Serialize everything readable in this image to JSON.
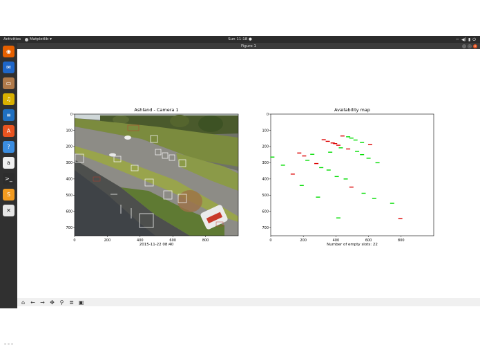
{
  "topbar": {
    "activities": "Activities",
    "app_name": "Matplotlib ▾",
    "clock": "Sun 11:18 ●",
    "tray_icons": [
      "wifi-icon",
      "volume-icon",
      "battery-icon",
      "power-icon"
    ]
  },
  "window": {
    "title": "Figure 1",
    "buttons": [
      "minimize",
      "maximize",
      "close"
    ]
  },
  "dock": {
    "apps": [
      {
        "name": "firefox-icon",
        "glyph": "◉",
        "color": "#e66000"
      },
      {
        "name": "thunderbird-icon",
        "glyph": "✉",
        "color": "#1e66c8"
      },
      {
        "name": "files-icon",
        "glyph": "▭",
        "color": "#b07a4a"
      },
      {
        "name": "rhythmbox-icon",
        "glyph": "♫",
        "color": "#d9b000"
      },
      {
        "name": "writer-icon",
        "glyph": "≡",
        "color": "#1f70c1"
      },
      {
        "name": "software-icon",
        "glyph": "A",
        "color": "#e95420"
      },
      {
        "name": "help-icon",
        "glyph": "?",
        "color": "#3b8de0"
      },
      {
        "name": "amazon-icon",
        "glyph": "a",
        "color": "#f0f0f0"
      },
      {
        "name": "terminal-icon",
        "glyph": ">_",
        "color": "#2d2d2d"
      },
      {
        "name": "sublime-icon",
        "glyph": "S",
        "color": "#f29b20"
      },
      {
        "name": "tool-icon",
        "glyph": "✕",
        "color": "#e6e6e6"
      }
    ]
  },
  "figure": {
    "left_title": "Ashland - Camera 1",
    "left_xlabel": "2015-11-22 08:40",
    "right_title": "Availability map",
    "right_xlabel": "Number of empty slots: 22"
  },
  "chart_data": [
    {
      "type": "image",
      "title": "Ashland - Camera 1",
      "xlabel": "2015-11-22 08:40",
      "xticks": [
        0,
        200,
        400,
        600,
        800
      ],
      "yticks": [
        0,
        100,
        200,
        300,
        400,
        500,
        600,
        700
      ],
      "xlim": [
        0,
        1000
      ],
      "ylim": [
        750,
        0
      ]
    },
    {
      "type": "scatter",
      "title": "Availability map",
      "xlabel": "Number of empty slots: 22",
      "xticks": [
        0,
        200,
        400,
        600,
        800
      ],
      "yticks": [
        0,
        100,
        200,
        300,
        400,
        500,
        600,
        700
      ],
      "xlim": [
        0,
        1000
      ],
      "ylim": [
        750,
        0
      ],
      "series": [
        {
          "color": "#00dd00",
          "points": [
            [
              10,
              265
            ],
            [
              75,
              315
            ],
            [
              190,
              440
            ],
            [
              225,
              285
            ],
            [
              255,
              248
            ],
            [
              290,
              512
            ],
            [
              310,
              330
            ],
            [
              355,
              345
            ],
            [
              365,
              235
            ],
            [
              405,
              385
            ],
            [
              415,
              640
            ],
            [
              430,
              208
            ],
            [
              460,
              400
            ],
            [
              475,
              140
            ],
            [
              495,
              148
            ],
            [
              520,
              160
            ],
            [
              530,
              230
            ],
            [
              560,
              175
            ],
            [
              560,
              250
            ],
            [
              570,
              488
            ],
            [
              600,
              272
            ],
            [
              635,
              520
            ],
            [
              655,
              300
            ],
            [
              745,
              550
            ]
          ]
        },
        {
          "color": "#dd0000",
          "points": [
            [
              135,
              370
            ],
            [
              175,
              240
            ],
            [
              205,
              258
            ],
            [
              280,
              305
            ],
            [
              325,
              158
            ],
            [
              350,
              168
            ],
            [
              380,
              178
            ],
            [
              395,
              182
            ],
            [
              415,
              192
            ],
            [
              440,
              135
            ],
            [
              475,
              215
            ],
            [
              495,
              450
            ],
            [
              610,
              188
            ],
            [
              795,
              645
            ]
          ]
        }
      ]
    }
  ],
  "toolbar": {
    "buttons": [
      {
        "name": "home-icon",
        "glyph": "⌂"
      },
      {
        "name": "back-icon",
        "glyph": "←"
      },
      {
        "name": "forward-icon",
        "glyph": "→"
      },
      {
        "name": "pan-icon",
        "glyph": "✥"
      },
      {
        "name": "zoom-icon",
        "glyph": "⚲"
      },
      {
        "name": "configure-icon",
        "glyph": "≣"
      },
      {
        "name": "save-icon",
        "glyph": "▣"
      }
    ]
  }
}
